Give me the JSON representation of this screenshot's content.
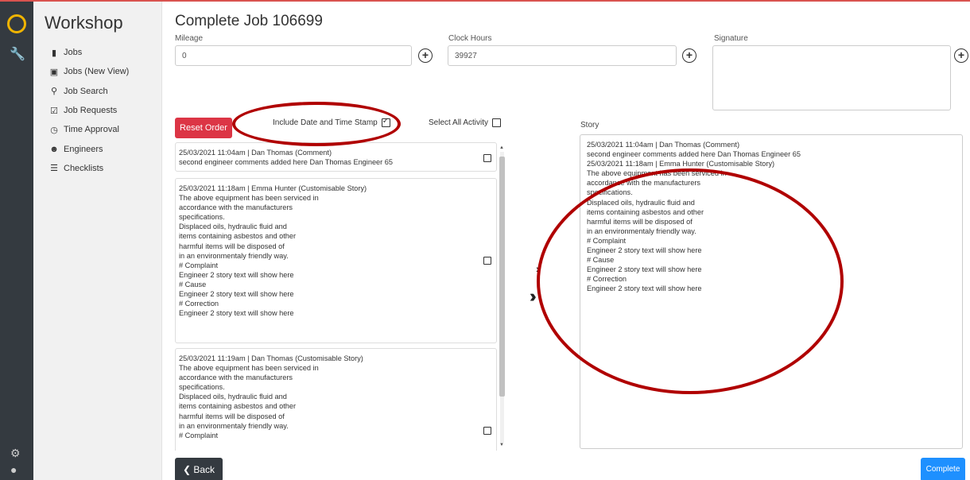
{
  "app": {
    "brand": "Workshop"
  },
  "nav": [
    {
      "label": "Jobs",
      "icon": "file-icon"
    },
    {
      "label": "Jobs (New View)",
      "icon": "board-icon"
    },
    {
      "label": "Job Search",
      "icon": "search-icon"
    },
    {
      "label": "Job Requests",
      "icon": "check-square-icon"
    },
    {
      "label": "Time Approval",
      "icon": "clock-icon"
    },
    {
      "label": "Engineers",
      "icon": "users-icon"
    },
    {
      "label": "Checklists",
      "icon": "list-check-icon"
    }
  ],
  "page": {
    "title": "Complete Job 106699"
  },
  "form": {
    "mileage_label": "Mileage",
    "mileage_value": "0",
    "clock_label": "Clock Hours",
    "clock_value": "39927",
    "signature_label": "Signature",
    "plus": "+"
  },
  "controls": {
    "reset": "Reset Order",
    "include_stamp": "Include Date and Time Stamp",
    "include_stamp_checked": true,
    "select_all": "Select All Activity",
    "select_all_checked": false,
    "story_label": "Story",
    "back": "Back",
    "complete": "Complete"
  },
  "activities": [
    {
      "lines": [
        "25/03/2021 11:04am | Dan Thomas (Comment)",
        "second engineer comments added here Dan Thomas Engineer 65"
      ]
    },
    {
      "lines": [
        "25/03/2021 11:18am | Emma Hunter (Customisable Story)",
        "The above equipment has been serviced in",
        "accordance with the manufacturers",
        "specifications.",
        "Displaced oils, hydraulic fluid and",
        "items containing asbestos and other",
        "harmful items will be disposed of",
        "in an environmentaly friendly way.",
        "# Complaint",
        "Engineer 2 story text will show here",
        "# Cause",
        "Engineer 2 story text will show here",
        "# Correction",
        "Engineer 2 story text will show here"
      ]
    },
    {
      "lines": [
        "25/03/2021 11:19am | Dan Thomas (Customisable Story)",
        "The above equipment has been serviced in",
        "accordance with the manufacturers",
        "specifications.",
        "Displaced oils, hydraulic fluid and",
        "items containing asbestos and other",
        "harmful items will be disposed of",
        "in an environmentaly friendly way.",
        "# Complaint"
      ]
    }
  ],
  "story_lines": [
    "25/03/2021 11:04am | Dan Thomas (Comment)",
    "second engineer comments added here Dan Thomas Engineer 65",
    "25/03/2021 11:18am | Emma Hunter (Customisable Story)",
    "The above equipment has been serviced in",
    "accordance with the manufacturers",
    "specifications.",
    "Displaced oils, hydraulic fluid and",
    "items containing asbestos and other",
    "harmful items will be disposed of",
    "in an environmentaly friendly way.",
    "# Complaint",
    "Engineer 2 story text will show here",
    "# Cause",
    "Engineer 2 story text will show here",
    "# Correction",
    "Engineer 2 story text will show here"
  ],
  "colors": {
    "accent": "#f0b400",
    "reset": "#dc3545",
    "complete": "#1e90ff",
    "annotation": "#b00000",
    "rail": "#343a40"
  }
}
